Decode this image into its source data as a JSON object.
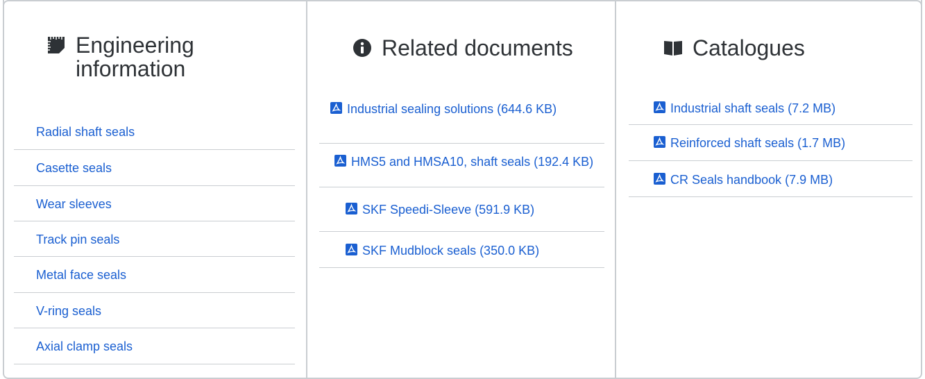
{
  "engineering": {
    "title": "Engineering\ninformation",
    "icon": "ruler-notebook-icon",
    "items": [
      "Radial shaft seals",
      "Casette seals",
      "Wear sleeves",
      "Track pin seals",
      "Metal face seals",
      "V-ring seals",
      "Axial clamp seals"
    ]
  },
  "related": {
    "title": "Related documents",
    "icon": "info-circle-icon",
    "items": [
      "Industrial sealing solutions (644.6 KB)",
      "HMS5 and HMSA10, shaft seals (192.4 KB)",
      "SKF Speedi-Sleeve (591.9 KB)",
      "SKF Mudblock seals (350.0 KB)"
    ]
  },
  "catalogues": {
    "title": "Catalogues",
    "icon": "open-book-icon",
    "items": [
      "Industrial shaft seals (7.2 MB)",
      "Reinforced shaft seals (1.7 MB)",
      "CR Seals handbook (7.9 MB)"
    ]
  },
  "colors": {
    "link": "#1a5fd1",
    "border": "#c9cdd1",
    "heading": "#2e3236"
  },
  "document_icon": "pdf-file-icon"
}
